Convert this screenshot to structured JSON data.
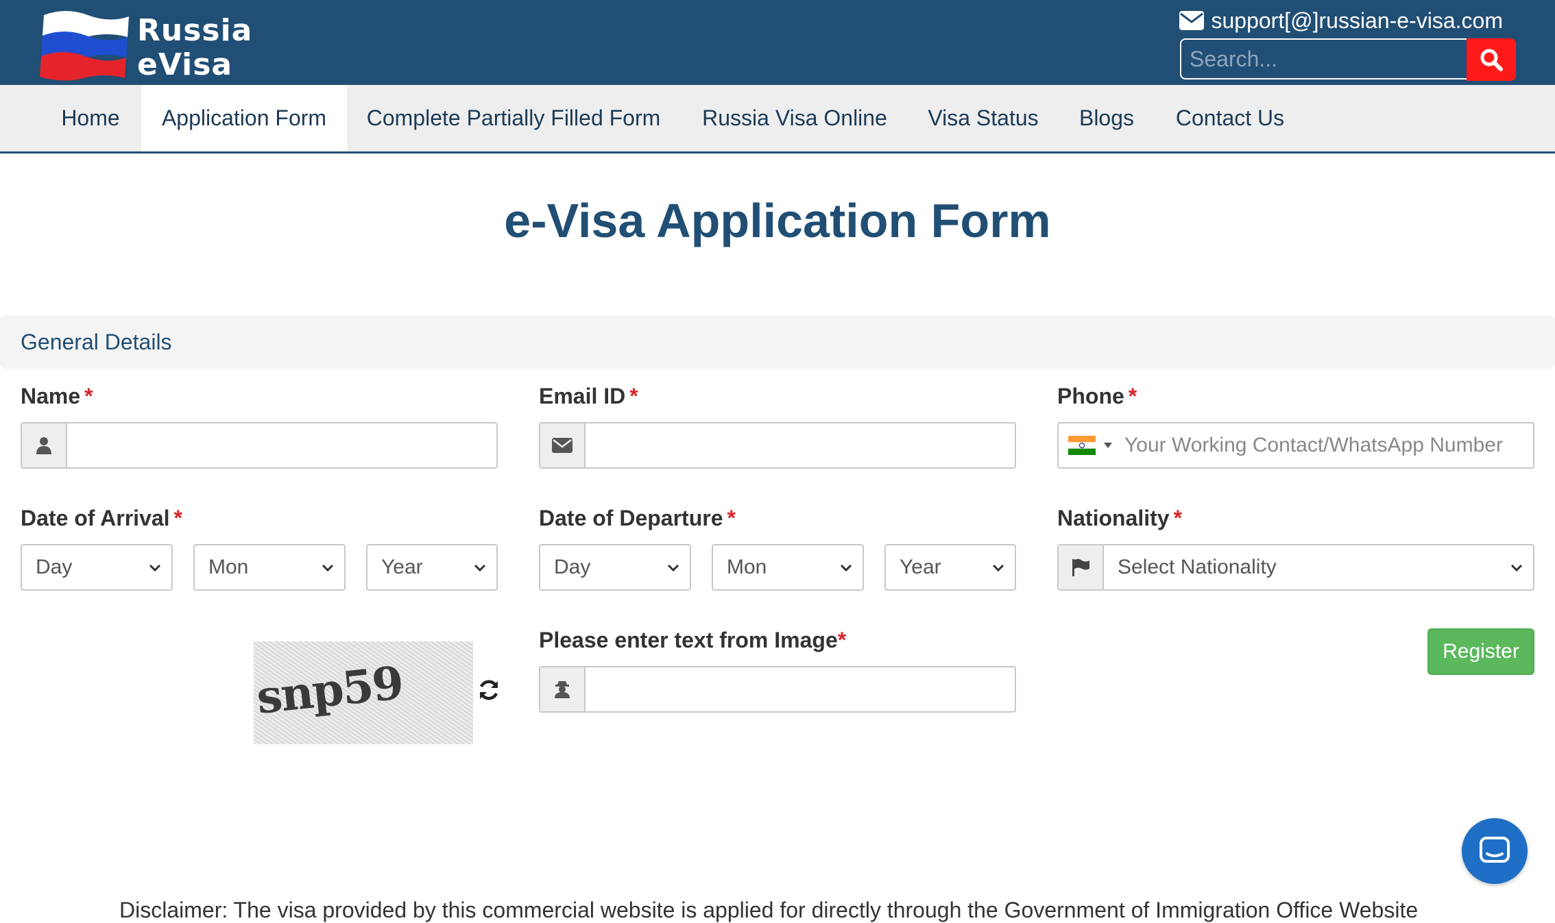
{
  "header": {
    "logo_line1": "Russia",
    "logo_line2": "eVisa",
    "email": "support[@]russian-e-visa.com",
    "search_placeholder": "Search..."
  },
  "nav": {
    "items": [
      "Home",
      "Application Form",
      "Complete Partially Filled Form",
      "Russia Visa Online",
      "Visa Status",
      "Blogs",
      "Contact Us"
    ],
    "active": "Application Form"
  },
  "page": {
    "title": "e-Visa Application Form",
    "section_title": "General Details"
  },
  "form": {
    "name_label": "Name",
    "email_label": "Email ID",
    "phone_label": "Phone",
    "phone_placeholder": "Your Working Contact/WhatsApp Number",
    "arrival_label": "Date of Arrival",
    "departure_label": "Date of Departure",
    "nationality_label": "Nationality",
    "nationality_placeholder": "Select Nationality",
    "date_day": "Day",
    "date_month": "Mon",
    "date_year": "Year",
    "captcha_label": "Please enter text from Image",
    "captcha_text": "snp59",
    "register_label": "Register",
    "required_mark": "*"
  },
  "footer": {
    "disclaimer": "Disclaimer: The visa provided by this commercial website is applied for directly through the Government of Immigration Office Website"
  },
  "colors": {
    "header_bg": "#214e74",
    "search_button": "#ff1a1a",
    "register_button": "#5cb85c",
    "required": "#d9252a",
    "chat_button": "#1f6fc6"
  }
}
